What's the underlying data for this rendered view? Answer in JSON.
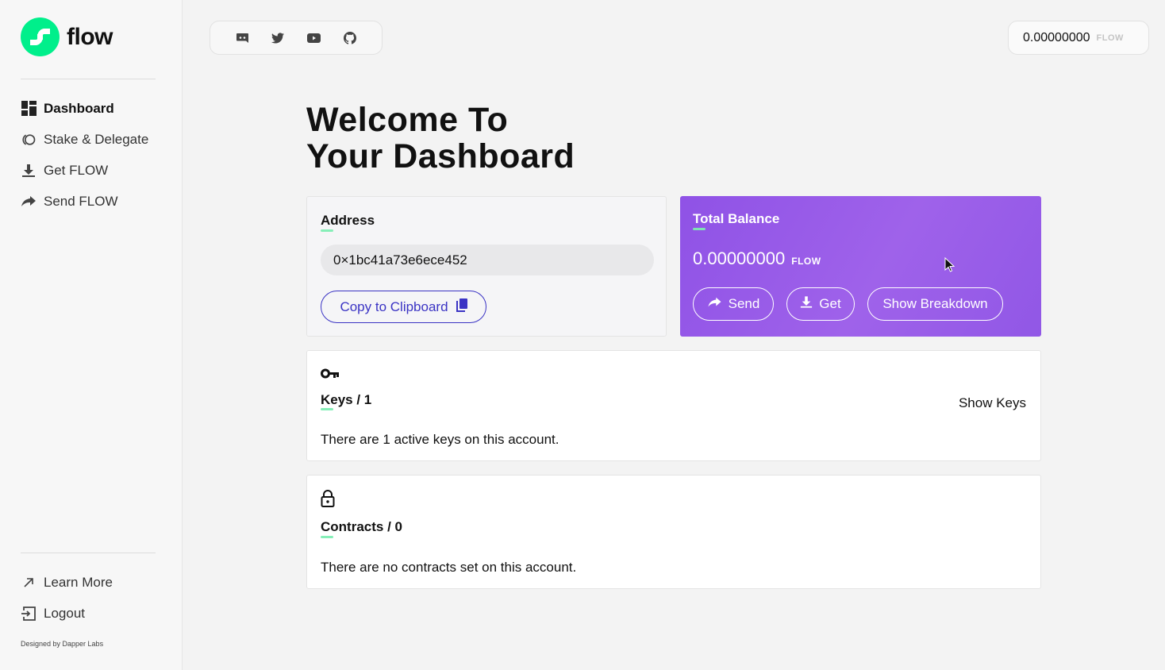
{
  "brand": {
    "name": "flow",
    "accent": "#00ef8b"
  },
  "sidebar": {
    "items": [
      {
        "label": "Dashboard",
        "icon": "dashboard-icon",
        "active": true
      },
      {
        "label": "Stake & Delegate",
        "icon": "stake-icon",
        "active": false
      },
      {
        "label": "Get FLOW",
        "icon": "download-icon",
        "active": false
      },
      {
        "label": "Send FLOW",
        "icon": "share-arrow-icon",
        "active": false
      }
    ],
    "bottom_items": [
      {
        "label": "Learn More",
        "icon": "external-arrow-icon"
      },
      {
        "label": "Logout",
        "icon": "logout-icon"
      }
    ],
    "credit": "Designed by Dapper Labs"
  },
  "social": [
    "discord-icon",
    "twitter-icon",
    "youtube-icon",
    "github-icon"
  ],
  "header_balance": {
    "amount": "0.00000000",
    "unit": "FLOW"
  },
  "main": {
    "title_line1": "Welcome To",
    "title_line2": "Your Dashboard",
    "address_card": {
      "label": "Address",
      "value": "0×1bc41a73e6ece452",
      "copy_label": "Copy to Clipboard"
    },
    "balance_card": {
      "label": "Total Balance",
      "amount": "0.00000000",
      "unit": "FLOW",
      "send_label": "Send",
      "get_label": "Get",
      "breakdown_label": "Show Breakdown",
      "color": "#9557e6"
    },
    "keys_card": {
      "label": "Keys / 1",
      "description": "There are 1 active keys on this account.",
      "show_label": "Show Keys"
    },
    "contracts_card": {
      "label": "Contracts / 0",
      "description": "There are no contracts set on this account."
    }
  }
}
